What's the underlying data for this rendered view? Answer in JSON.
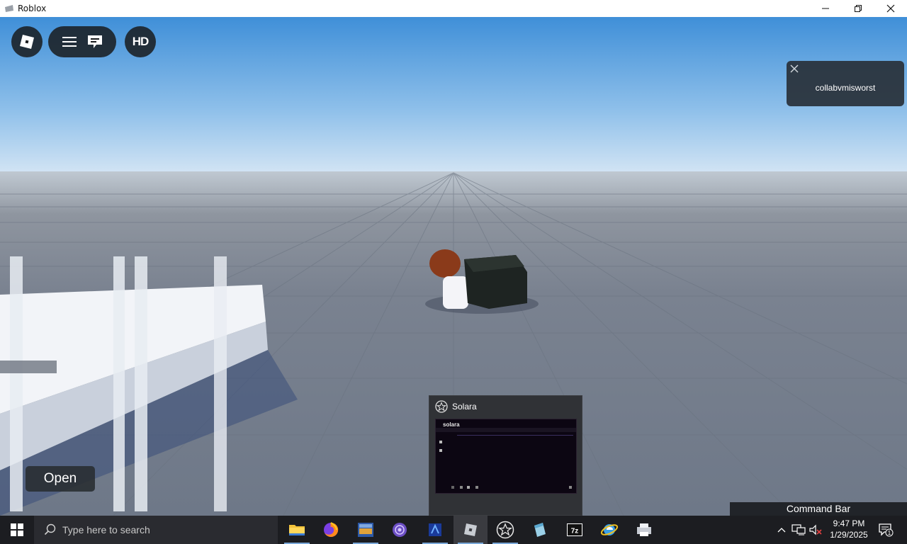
{
  "window": {
    "title": "Roblox"
  },
  "roblox_ui": {
    "hd_label": "HD",
    "notification": {
      "text": "collabvmisworst"
    },
    "open_button": "Open",
    "command_bar": "Command Bar"
  },
  "taskbar_preview": {
    "title": "Solara",
    "thumbnail_label": "solara"
  },
  "taskbar": {
    "search_placeholder": "Type here to search",
    "apps": [
      {
        "name": "file-explorer",
        "active": false
      },
      {
        "name": "firefox",
        "active": false
      },
      {
        "name": "app-2025",
        "active": false
      },
      {
        "name": "tor-like-browser",
        "active": false
      },
      {
        "name": "blue-app",
        "active": false
      },
      {
        "name": "roblox",
        "active": true
      },
      {
        "name": "solara",
        "active": false
      },
      {
        "name": "notepad-like",
        "active": false
      },
      {
        "name": "7zip",
        "active": false
      },
      {
        "name": "internet-explorer",
        "active": false
      },
      {
        "name": "printer-app",
        "active": false
      }
    ],
    "clock": {
      "time": "9:47 PM",
      "date": "1/29/2025"
    },
    "notification_count": "1"
  },
  "colors": {
    "sky_top": "#3f8fd8",
    "sky_bottom": "#cfe3f5",
    "floor": "#7c8593",
    "taskbar": "#1c1d21"
  }
}
